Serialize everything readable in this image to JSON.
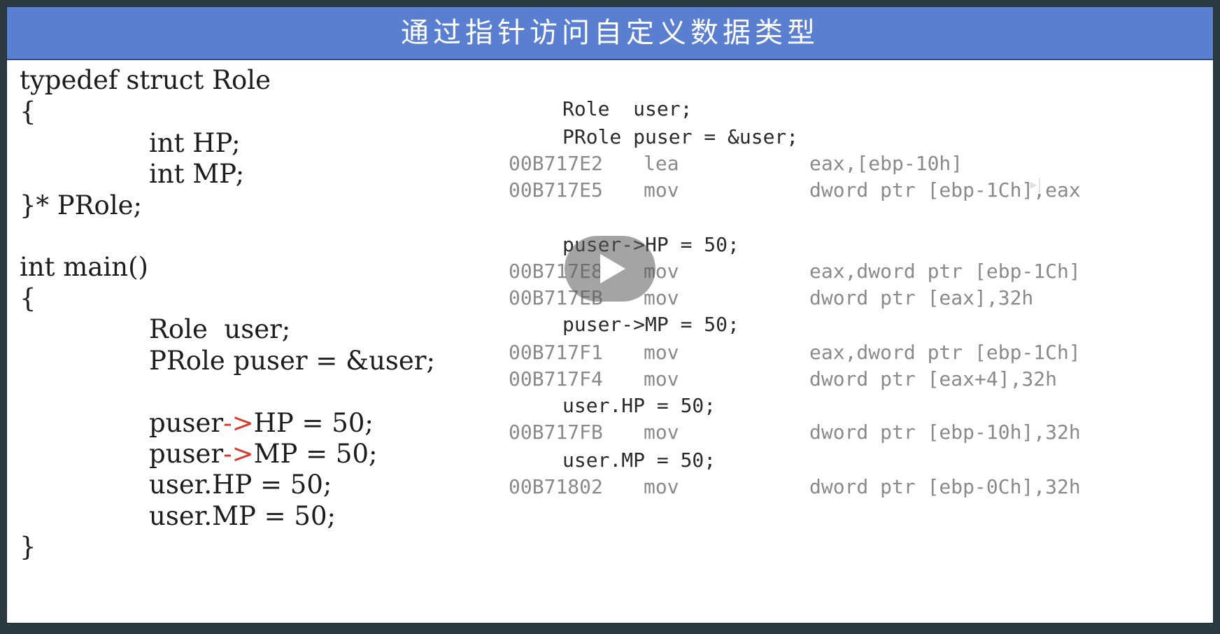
{
  "header": {
    "title": "通过指针访问自定义数据类型"
  },
  "source_code": [
    {
      "text": "typedef struct Role",
      "indent": false
    },
    {
      "text": "{",
      "indent": false
    },
    {
      "text": "int HP;",
      "indent": true
    },
    {
      "text": "int MP;",
      "indent": true
    },
    {
      "text": "}* PRole;",
      "indent": false
    },
    {
      "text": "int main()",
      "indent": false
    },
    {
      "text": "{",
      "indent": false
    },
    {
      "text": "Role  user;",
      "indent": true
    },
    {
      "text": "PRole puser = &user;",
      "indent": true
    },
    {
      "pre": "puser",
      "arrow": "->",
      "post": "HP = 50;",
      "indent": true
    },
    {
      "pre": "puser",
      "arrow": "->",
      "post": "MP = 50;",
      "indent": true
    },
    {
      "text": "user.HP = 50;",
      "indent": true
    },
    {
      "text": "user.MP = 50;",
      "indent": true
    },
    {
      "text": "}",
      "indent": false
    }
  ],
  "disassembly": [
    {
      "kind": "src",
      "text": "Role  user;"
    },
    {
      "kind": "src",
      "text": "PRole puser = &user;"
    },
    {
      "kind": "ins",
      "addr": "00B717E2",
      "op": "lea",
      "arg": "eax,[ebp-10h]"
    },
    {
      "kind": "ins",
      "addr": "00B717E5",
      "op": "mov",
      "arg": "dword ptr [ebp-1Ch],eax"
    },
    {
      "kind": "src",
      "text": "puser->HP = 50;"
    },
    {
      "kind": "ins",
      "addr": "00B717E8",
      "op": "mov",
      "arg": "eax,dword ptr [ebp-1Ch]"
    },
    {
      "kind": "ins",
      "addr": "00B717EB",
      "op": "mov",
      "arg": "dword ptr [eax],32h"
    },
    {
      "kind": "src",
      "text": "puser->MP = 50;"
    },
    {
      "kind": "ins",
      "addr": "00B717F1",
      "op": "mov",
      "arg": "eax,dword ptr [ebp-1Ch]"
    },
    {
      "kind": "ins",
      "addr": "00B717F4",
      "op": "mov",
      "arg": "dword ptr [eax+4],32h"
    },
    {
      "kind": "src",
      "text": "user.HP = 50;"
    },
    {
      "kind": "ins",
      "addr": "00B717FB",
      "op": "mov",
      "arg": "dword ptr [ebp-10h],32h"
    },
    {
      "kind": "src",
      "text": "user.MP = 50;"
    },
    {
      "kind": "ins",
      "addr": "00B71802",
      "op": "mov",
      "arg": "dword ptr [ebp-0Ch],32h"
    }
  ],
  "icons": {
    "step": "step-icon",
    "play": "play-icon"
  },
  "colors": {
    "header_bg": "#5a7fd0",
    "arrow": "#d63a2c"
  }
}
